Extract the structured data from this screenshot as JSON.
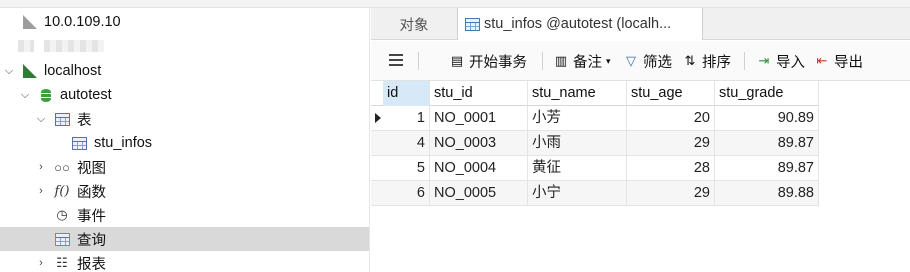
{
  "tree": {
    "connection_1": {
      "label": "10.0.109.10"
    },
    "localhost": {
      "label": "localhost"
    },
    "database": {
      "label": "autotest"
    },
    "tables_group": {
      "label": "表"
    },
    "table_item": {
      "label": "stu_infos"
    },
    "views_group": {
      "label": "视图"
    },
    "functions_group": {
      "label": "函数"
    },
    "events_group": {
      "label": "事件"
    },
    "queries_group": {
      "label": "查询"
    },
    "reports_group": {
      "label": "报表"
    }
  },
  "tabs": {
    "objects": "对象",
    "active": "stu_infos @autotest (localh..."
  },
  "toolbar": {
    "begin_transaction": "开始事务",
    "note": "备注",
    "filter": "筛选",
    "sort": "排序",
    "import": "导入",
    "export": "导出"
  },
  "grid": {
    "columns": [
      "id",
      "stu_id",
      "stu_name",
      "stu_age",
      "stu_grade"
    ],
    "rows": [
      [
        "1",
        "NO_0001",
        "小芳",
        "20",
        "90.89"
      ],
      [
        "4",
        "NO_0003",
        "小雨",
        "29",
        "89.87"
      ],
      [
        "5",
        "NO_0004",
        "黄征",
        "28",
        "89.87"
      ],
      [
        "6",
        "NO_0005",
        "小宁",
        "29",
        "89.88"
      ]
    ]
  }
}
